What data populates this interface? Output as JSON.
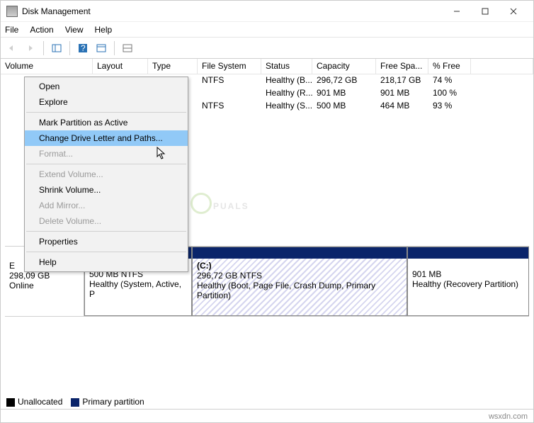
{
  "window": {
    "title": "Disk Management"
  },
  "menubar": {
    "file": "File",
    "action": "Action",
    "view": "View",
    "help": "Help"
  },
  "columns": {
    "volume": "Volume",
    "layout": "Layout",
    "type": "Type",
    "fs": "File System",
    "status": "Status",
    "capacity": "Capacity",
    "freespace": "Free Spa...",
    "pctfree": "% Free"
  },
  "rows": [
    {
      "volume": "",
      "layout": "",
      "type": "",
      "fs": "NTFS",
      "status": "Healthy (B...",
      "capacity": "296,72 GB",
      "free": "218,17 GB",
      "pct": "74 %"
    },
    {
      "volume": "",
      "layout": "",
      "type": "",
      "fs": "",
      "status": "Healthy (R...",
      "capacity": "901 MB",
      "free": "901 MB",
      "pct": "100 %"
    },
    {
      "volume": "",
      "layout": "",
      "type": "",
      "fs": "NTFS",
      "status": "Healthy (S...",
      "capacity": "500 MB",
      "free": "464 MB",
      "pct": "93 %"
    }
  ],
  "disk_sidebar": {
    "name_partial": "E",
    "size": "298,09 GB",
    "state": "Online"
  },
  "partitions": [
    {
      "line1": "500 MB NTFS",
      "line2": "Healthy (System, Active, P"
    },
    {
      "title": "(C:)",
      "line1": "296,72 GB NTFS",
      "line2": "Healthy (Boot, Page File, Crash Dump, Primary Partition)"
    },
    {
      "line1": "901 MB",
      "line2": "Healthy (Recovery Partition)"
    }
  ],
  "legend": {
    "unalloc": "Unallocated",
    "primary": "Primary partition"
  },
  "ctx": {
    "open": "Open",
    "explore": "Explore",
    "mark": "Mark Partition as Active",
    "change": "Change Drive Letter and Paths...",
    "format": "Format...",
    "extend": "Extend Volume...",
    "shrink": "Shrink Volume...",
    "addmirror": "Add Mirror...",
    "delete": "Delete Volume...",
    "props": "Properties",
    "help": "Help"
  },
  "watermark": "PUALS",
  "footer_note": "wsxdn.com"
}
